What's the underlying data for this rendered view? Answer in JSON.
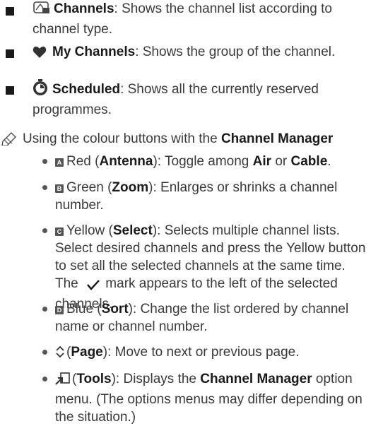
{
  "items": [
    {
      "label": "Channels",
      "desc": ": Shows the channel list according to channel type."
    },
    {
      "label": "My Channels",
      "desc": ": Shows the group of the channel."
    },
    {
      "label": "Scheduled",
      "desc": ": Shows all the currently reserved programmes."
    }
  ],
  "note": {
    "text": "Using the colour buttons with the ",
    "bold": "Channel Manager"
  },
  "buttons": {
    "red": {
      "key": "A",
      "color": "Red (",
      "name": "Antenna",
      "mid": "): Toggle among ",
      "b1": "Air",
      "or": " or ",
      "b2": "Cable",
      "end": "."
    },
    "green": {
      "key": "B",
      "color": "Green (",
      "name": "Zoom",
      "desc": "): Enlarges or shrinks a channel number."
    },
    "yellow": {
      "key": "C",
      "color": "Yellow (",
      "name": "Select",
      "desc": "): Selects multiple channel lists. Select desired channels and press the Yellow button to set all the selected channels at the same time. The",
      "desc2": " mark appears to the left of the selected channels."
    },
    "blue": {
      "key": "D",
      "color": "Blue (",
      "name": "Sort",
      "desc": "): Change the list ordered by channel name or channel number."
    },
    "page": {
      "name": "Page",
      "desc": "): Move to next or previous page."
    },
    "tools": {
      "name": "Tools",
      "mid": "): Displays the ",
      "bold": "Channel Manager",
      "desc": " option menu. (The options menus may differ depending on the situation.)"
    }
  }
}
